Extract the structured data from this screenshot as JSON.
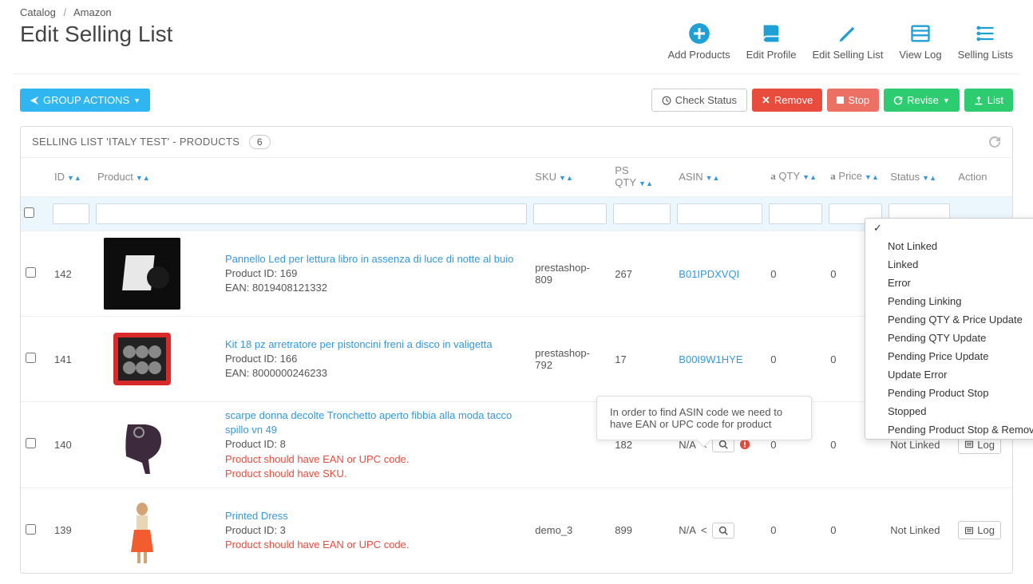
{
  "breadcrumb": {
    "root": "Catalog",
    "current": "Amazon"
  },
  "page_title": "Edit Selling List",
  "toolbar": [
    {
      "name": "add-products",
      "icon": "plus-circle",
      "label": "Add Products"
    },
    {
      "name": "edit-profile",
      "icon": "book",
      "label": "Edit Profile"
    },
    {
      "name": "edit-selling-list",
      "icon": "pencil",
      "label": "Edit Selling List"
    },
    {
      "name": "view-log",
      "icon": "list",
      "label": "View Log"
    },
    {
      "name": "selling-lists",
      "icon": "stack",
      "label": "Selling Lists"
    }
  ],
  "actions": {
    "group_actions": "GROUP ACTIONS",
    "check_status": "Check Status",
    "remove": "Remove",
    "stop": "Stop",
    "revise": "Revise",
    "list": "List"
  },
  "panel": {
    "title": "SELLING LIST 'ITALY TEST' - PRODUCTS",
    "count": "6"
  },
  "columns": {
    "id": "ID",
    "product": "Product",
    "sku": "SKU",
    "psqty": "PS QTY",
    "asin": "ASIN",
    "aqty": "QTY",
    "aprice": "Price",
    "status": "Status",
    "action": "Action"
  },
  "amazon_prefix": "a",
  "status_options": [
    "",
    "Not Linked",
    "Linked",
    "Error",
    "Pending Linking",
    "Pending QTY & Price Update",
    "Pending QTY Update",
    "Pending Price Update",
    "Update Error",
    "Pending Product Stop",
    "Stopped",
    "Pending Product Stop & Remove"
  ],
  "tooltip_text": "In order to find ASIN code we need to have EAN or UPC code for product",
  "log_label": "Log",
  "na_label": "N/A",
  "rows": [
    {
      "id": "142",
      "title": "Pannello Led per lettura libro in assenza di luce di notte al buio",
      "product_id_line": "Product ID: 169",
      "ean_line": "EAN: 8019408121332",
      "errors": [],
      "sku": "prestashop-809",
      "psqty": "267",
      "asin": "B01IPDXVQI",
      "asin_is_link": true,
      "aqty": "0",
      "aprice": "0",
      "status": "",
      "img_bg": "#1a1a1a"
    },
    {
      "id": "141",
      "title": "Kit 18 pz arretratore per pistoncini freni a disco in valigetta",
      "product_id_line": "Product ID: 166",
      "ean_line": "EAN: 8000000246233",
      "errors": [],
      "sku": "prestashop-792",
      "psqty": "17",
      "asin": "B00I9W1HYE",
      "asin_is_link": true,
      "aqty": "0",
      "aprice": "0",
      "status": "",
      "img_bg": "#e8e8e8"
    },
    {
      "id": "140",
      "title": "scarpe donna decolte Tronchetto aperto fibbia alla moda tacco spillo vn 49",
      "product_id_line": "Product ID: 8",
      "ean_line": "",
      "errors": [
        "Product should have EAN or UPC code.",
        "Product should have SKU."
      ],
      "sku": "",
      "psqty": "182",
      "asin": "N/A",
      "asin_is_link": false,
      "show_search": true,
      "show_warn": true,
      "aqty": "0",
      "aprice": "0",
      "status": "Not Linked",
      "img_bg": "#f5f5f5"
    },
    {
      "id": "139",
      "title": "Printed Dress",
      "product_id_line": "Product ID: 3",
      "ean_line": "",
      "errors": [
        "Product should have EAN or UPC code."
      ],
      "sku": "demo_3",
      "psqty": "899",
      "asin": "N/A",
      "asin_is_link": false,
      "show_search": true,
      "show_warn": false,
      "aqty": "0",
      "aprice": "0",
      "status": "Not Linked",
      "img_bg": "#f5f5f5"
    }
  ]
}
